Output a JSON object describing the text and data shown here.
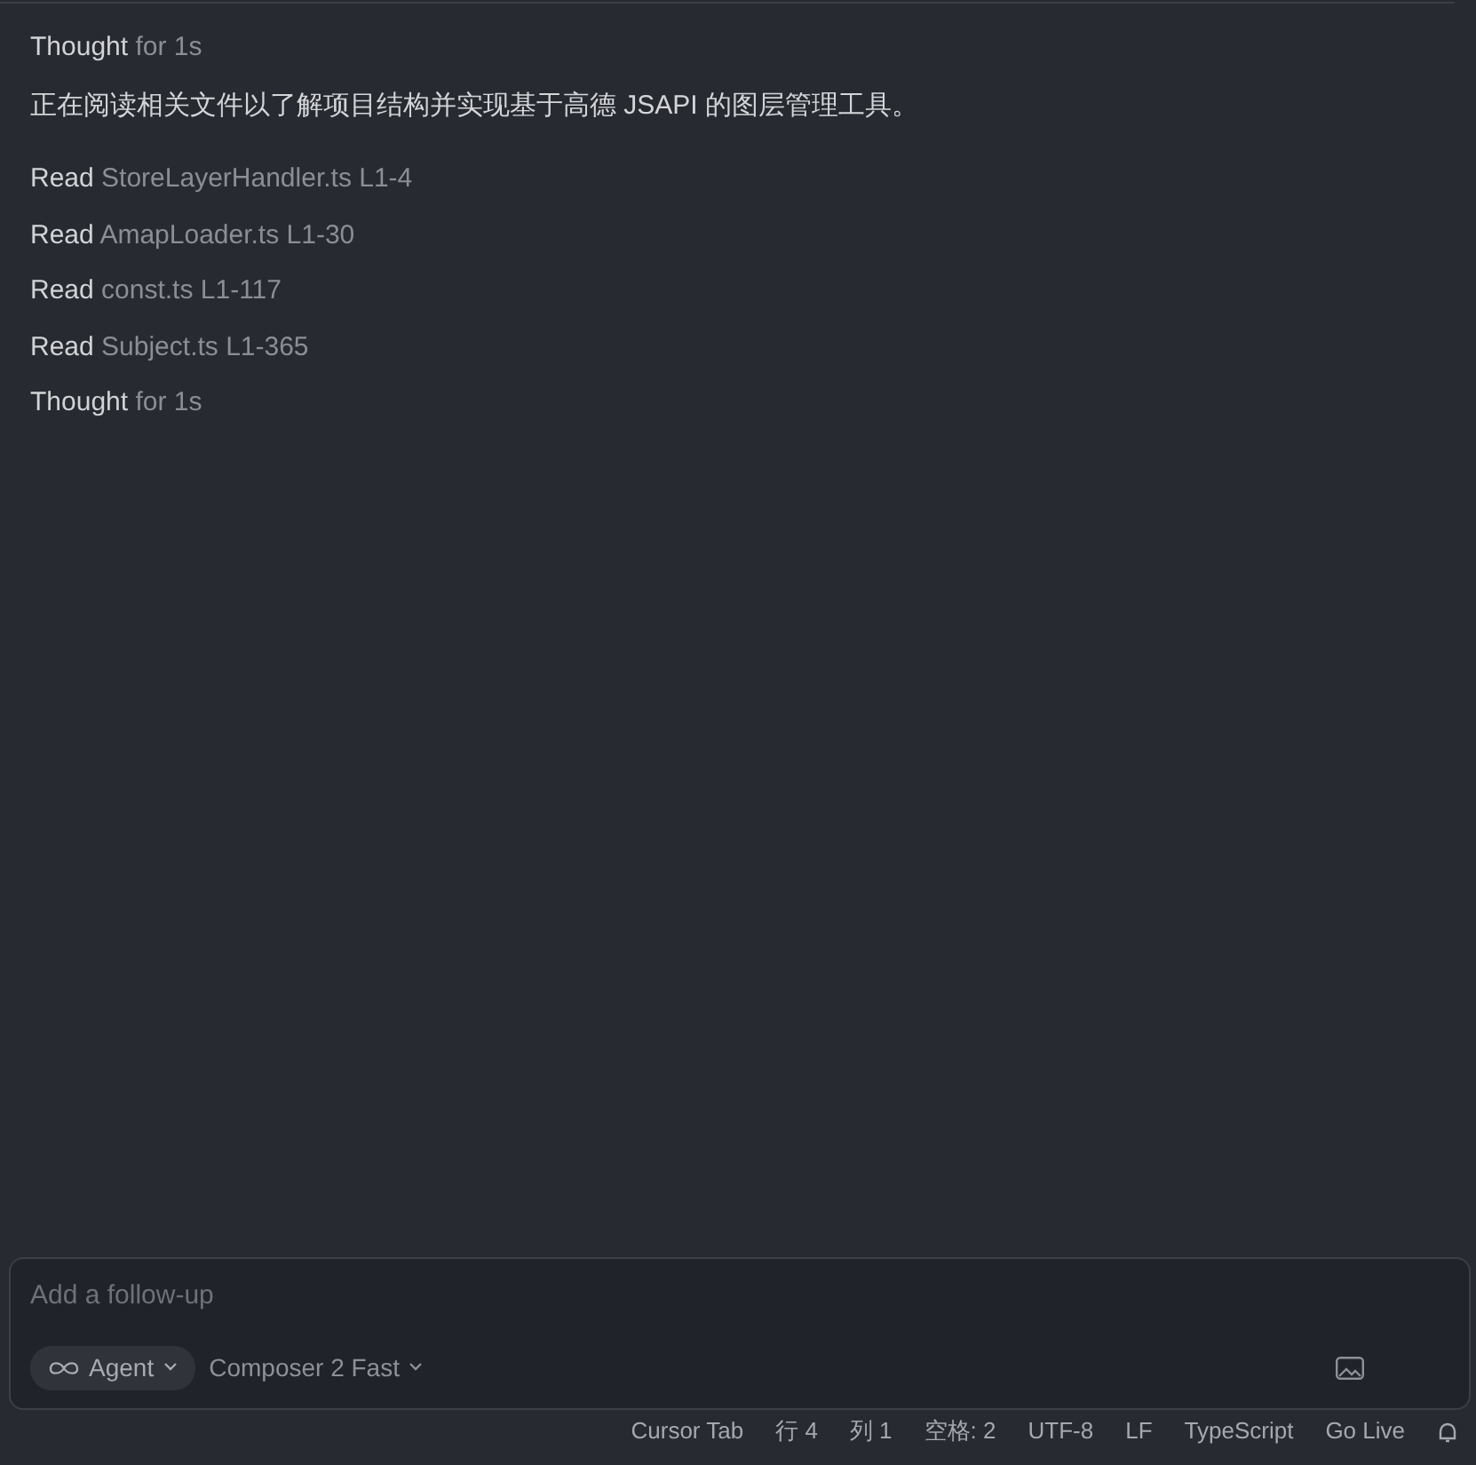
{
  "log": [
    {
      "kind": "status",
      "verb": "Thought",
      "detail": "for 1s"
    },
    {
      "kind": "message",
      "text": "正在阅读相关文件以了解项目结构并实现基于高德 JSAPI 的图层管理工具。"
    },
    {
      "kind": "status",
      "verb": "Read",
      "detail": "StoreLayerHandler.ts L1-4"
    },
    {
      "kind": "status",
      "verb": "Read",
      "detail": "AmapLoader.ts L1-30"
    },
    {
      "kind": "status",
      "verb": "Read",
      "detail": "const.ts L1-117"
    },
    {
      "kind": "status",
      "verb": "Read",
      "detail": "Subject.ts L1-365"
    },
    {
      "kind": "status",
      "verb": "Thought",
      "detail": "for 1s"
    }
  ],
  "composer": {
    "placeholder": "Add a follow-up",
    "mode": "Agent",
    "model": "Composer 2 Fast"
  },
  "status_bar": [
    "Cursor Tab",
    "行 4",
    "列 1",
    "空格: 2",
    "UTF-8",
    "LF",
    "TypeScript",
    "Go Live"
  ]
}
